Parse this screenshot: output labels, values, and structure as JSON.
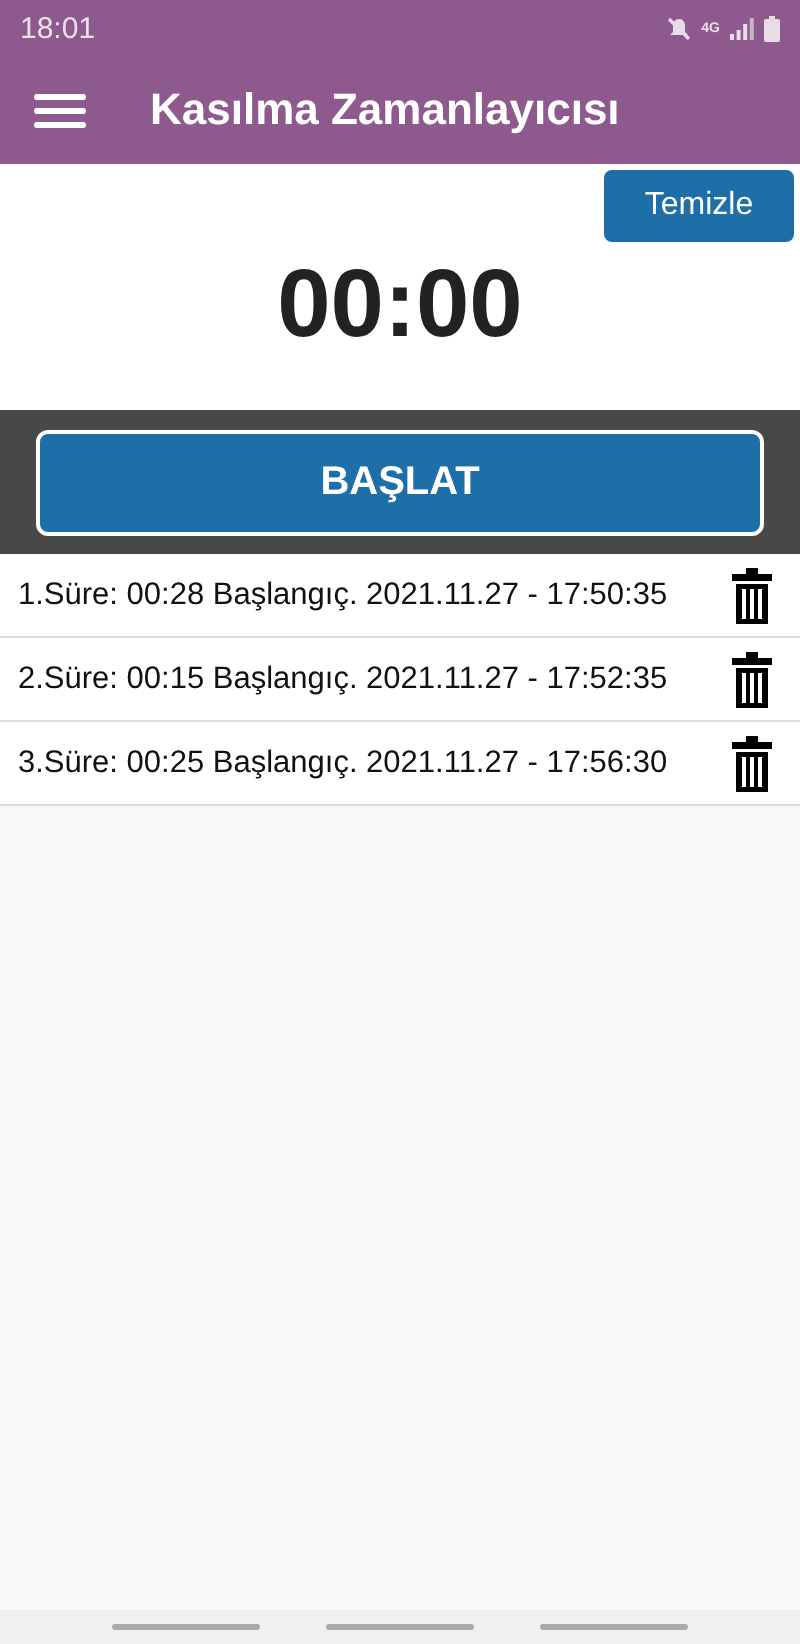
{
  "status_bar": {
    "time": "18:01",
    "network": "4G"
  },
  "app_bar": {
    "title": "Kasılma Zamanlayıcısı"
  },
  "clear_button": "Temizle",
  "timer": "00:00",
  "start_button": "BAŞLAT",
  "records": [
    {
      "text": "1.Süre: 00:28 Başlangıç. 2021.11.27 - 17:50:35"
    },
    {
      "text": "2.Süre: 00:15 Başlangıç. 2021.11.27 - 17:52:35"
    },
    {
      "text": "3.Süre: 00:25 Başlangıç. 2021.11.27 - 17:56:30"
    }
  ]
}
